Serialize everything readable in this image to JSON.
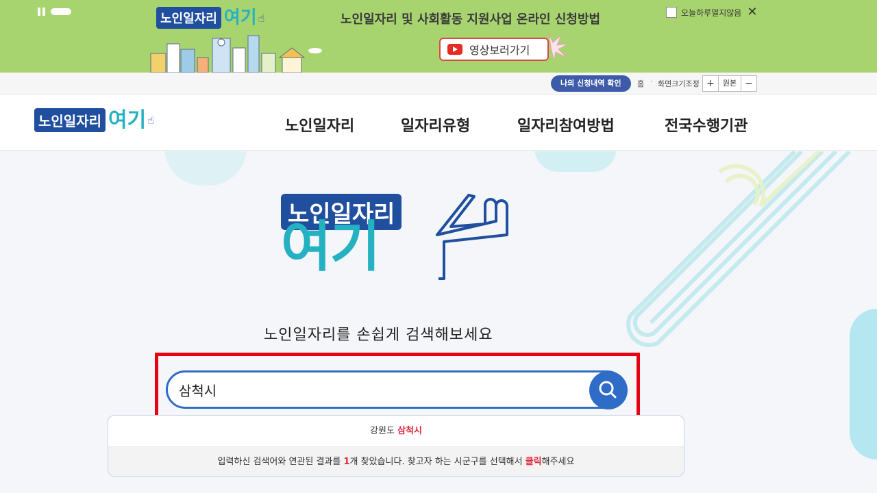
{
  "banner": {
    "logo_box": "노인일자리",
    "logo_teal": "여기",
    "logo_finger": "☝",
    "title": "노인일자리 및 사회활동 지원사업 온라인 신청방법",
    "video_button": "영상보러가기",
    "close_today_label": "오늘하루열지않음",
    "close_icon": "✕"
  },
  "utility": {
    "my_application": "나의 신청내역 확인",
    "home": "홈",
    "zoom_label": "화면크기조정",
    "zoom_in": "+",
    "zoom_reset": "원본",
    "zoom_out": "−"
  },
  "header": {
    "logo_box": "노인일자리",
    "logo_teal": "여기",
    "logo_finger": "☝",
    "nav": [
      "노인일자리",
      "일자리유형",
      "일자리참여방법",
      "전국수행기관"
    ]
  },
  "main": {
    "big_logo_box": "노인일자리",
    "big_logo_teal": "여기",
    "subtitle": "노인일자리를 손쉽게 검색해보세요",
    "search_value": "삼척시",
    "result": {
      "region": "강원도",
      "city": "삼척시"
    },
    "message": {
      "prefix": "입력하신 검색어와 연관된 결과를 ",
      "count": "1",
      "middle": "개 찾았습니다. 찾고자 하는 시군구를 선택해서 ",
      "click": "클릭",
      "suffix": "해주세요"
    }
  },
  "colors": {
    "banner_bg": "#a8d470",
    "brand_blue": "#1f4f9e",
    "brand_teal": "#25b1c2",
    "search_blue": "#2f6cc8",
    "highlight_red": "#e0283a",
    "frame_red": "#e60012"
  }
}
